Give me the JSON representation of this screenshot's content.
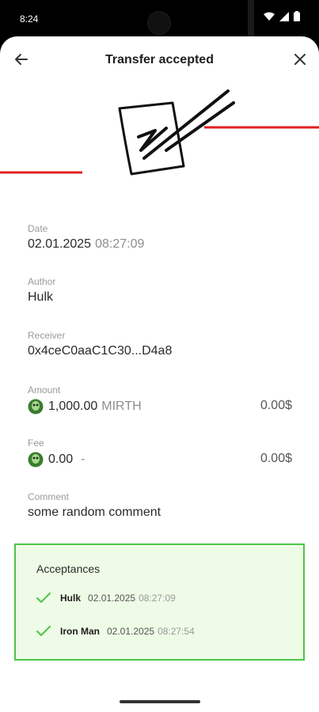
{
  "status": {
    "time": "8:24"
  },
  "header": {
    "title": "Transfer accepted",
    "back_icon": "arrow-left-icon",
    "close_icon": "close-icon"
  },
  "fields": {
    "date": {
      "label": "Date",
      "date": "02.01.2025",
      "time": "08:27:09"
    },
    "author": {
      "label": "Author",
      "value": "Hulk"
    },
    "receiver": {
      "label": "Receiver",
      "value": "0x4ceC0aaC1C30...D4a8"
    },
    "amount": {
      "label": "Amount",
      "value": "1,000.00",
      "unit": "MIRTH",
      "fiat": "0.00$"
    },
    "fee": {
      "label": "Fee",
      "value": "0.00",
      "unit": "-",
      "fiat": "0.00$"
    },
    "comment": {
      "label": "Comment",
      "value": "some random comment"
    }
  },
  "acceptances": {
    "title": "Acceptances",
    "items": [
      {
        "name": "Hulk",
        "date": "02.01.2025",
        "time": "08:27:09"
      },
      {
        "name": "Iron Man",
        "date": "02.01.2025",
        "time": "08:27:54"
      }
    ]
  },
  "colors": {
    "accent_green": "#4fc44a",
    "acceptance_bg": "#eefbe6",
    "decor_red": "#e02020"
  }
}
